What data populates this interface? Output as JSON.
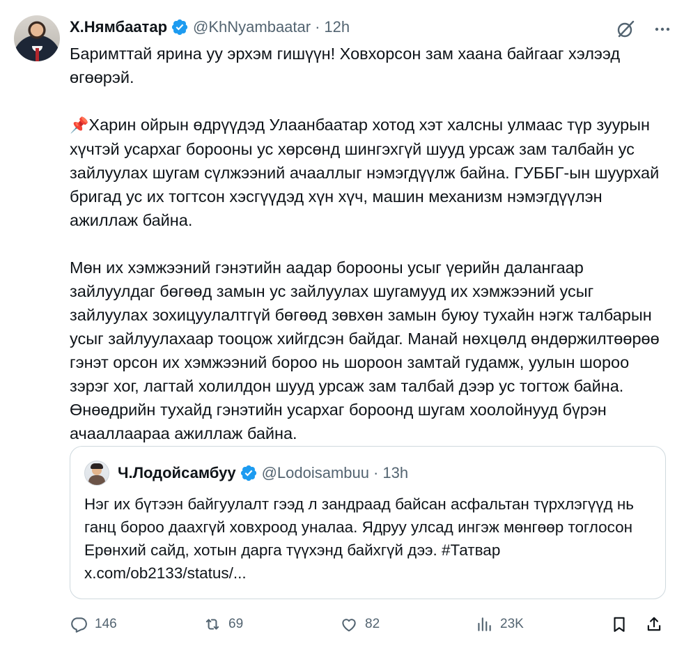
{
  "tweet": {
    "author_name": "Х.Нямбаатар",
    "handle": "@KhNyambaatar",
    "separator": "·",
    "time": "12h",
    "paragraphs": [
      "Баримттай ярина уу эрхэм гишүүн! Ховхорсон зам хаана байгааг хэлээд өгөөрэй.",
      "Харин ойрын өдрүүдэд Улаанбаатар хотод хэт халсны улмаас түр зуурын хүчтэй усархаг борооны ус хөрсөнд шингэхгүй шууд урсаж зам талбайн ус зайлуулах шугам сүлжээний ачааллыг нэмэгдүүлж байна. ГУББГ-ын шуурхай бригад ус их тогтсон хэсгүүдэд хүн хүч, машин механизм нэмэгдүүлэн ажиллаж байна.",
      "Мөн их хэмжээний гэнэтийн аадар борооны усыг үерийн далангаар зайлуулдаг бөгөөд замын ус зайлуулах шугамууд их хэмжээний усыг зайлуулах зохицуулалтгүй бөгөөд зөвхөн замын буюу тухайн нэгж талбарын усыг зайлуулахаар тооцож хийгдсэн байдаг. Манай нөхцөлд өндөржилтөөрөө гэнэт орсон их хэмжээний бороо нь шороон замтай гудамж, уулын шороо зэрэг хог, лагтай холилдон шууд урсаж зам талбай дээр ус тогтож байна. Өнөөдрийн тухайд гэнэтийн усархаг бороонд шугам хоолойнууд бүрэн ачааллаараа ажиллаж байна."
    ],
    "pin_emoji": "📌"
  },
  "quote": {
    "author_name": "Ч.Лодойсамбуу",
    "handle": "@Lodoisambuu",
    "separator": "·",
    "time": "13h",
    "text_line1": "Нэг их бүтээн байгуулалт гээд л зандраад байсан асфальтан түрхлэгүүд нь ганц бороо даахгүй ховхроод уналаа. Ядруу улсад ингэж мөнгөөр тоглосон Ерөнхий сайд, хотын дарга түүхэнд байхгүй дээ. #Татвар",
    "text_link": "x.com/ob2133/status/..."
  },
  "actions": {
    "replies": "146",
    "reposts": "69",
    "likes": "82",
    "views": "23K"
  },
  "icons": {
    "verified": "verified-badge-icon",
    "grok": "grok-icon",
    "more": "more-icon",
    "reply": "reply-icon",
    "repost": "repost-icon",
    "like": "heart-icon",
    "views": "views-icon",
    "bookmark": "bookmark-icon",
    "share": "share-icon"
  },
  "colors": {
    "verified_blue": "#1d9bf0",
    "text": "#0f1419",
    "secondary": "#536471",
    "border": "#cfd9de"
  }
}
